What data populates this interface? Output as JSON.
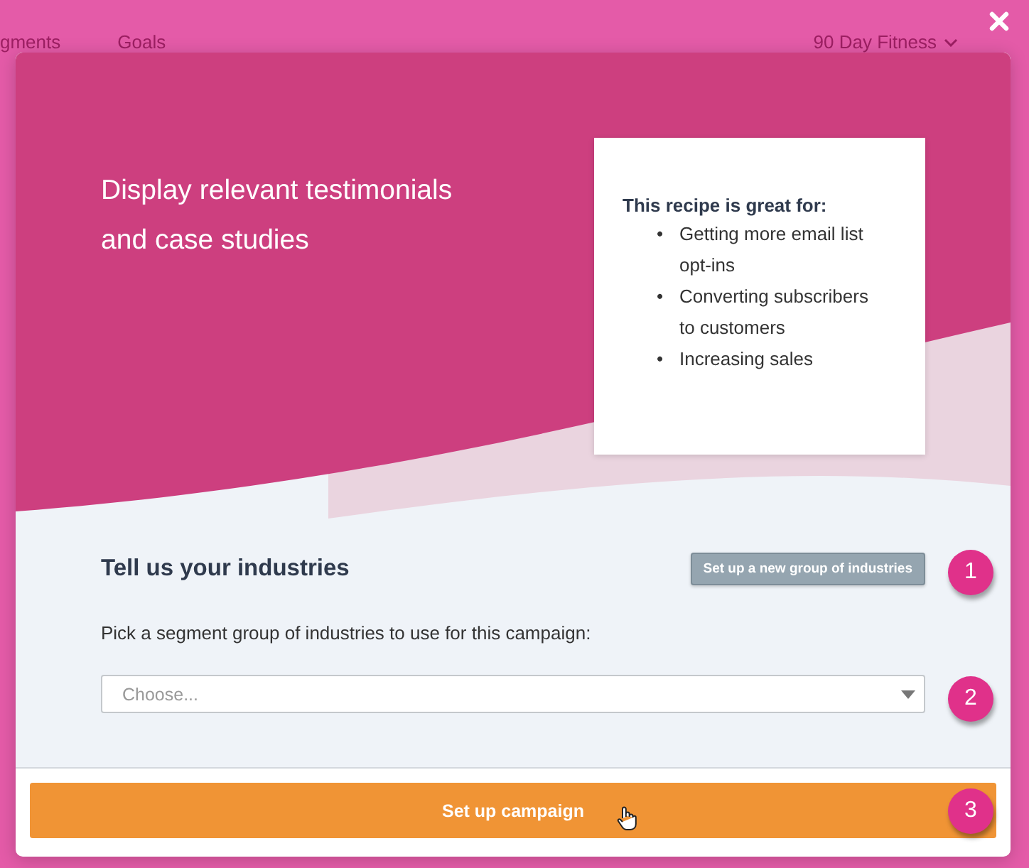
{
  "background_nav": {
    "items": [
      "gments",
      "Goals"
    ],
    "account": "90 Day Fitness"
  },
  "modal": {
    "title_lines": [
      "Display relevant testimonials",
      "and case studies"
    ],
    "recipe_card": {
      "heading": "This recipe is great for:",
      "bullets": [
        {
          "marker": "•",
          "lines": [
            "Getting more email list",
            "opt-ins"
          ]
        },
        {
          "marker": "•",
          "lines": [
            "Converting subscribers",
            "to customers"
          ]
        },
        {
          "marker": "•",
          "lines": [
            "Increasing sales"
          ]
        }
      ]
    },
    "section_title": "Tell us your industries",
    "new_group_button": "Set up a new group of industries",
    "prompt": "Pick a segment group of industries to use for this campaign:",
    "select": {
      "placeholder": "Choose..."
    },
    "submit_button": "Set up campaign"
  },
  "step_badges": [
    "1",
    "2",
    "3"
  ]
}
